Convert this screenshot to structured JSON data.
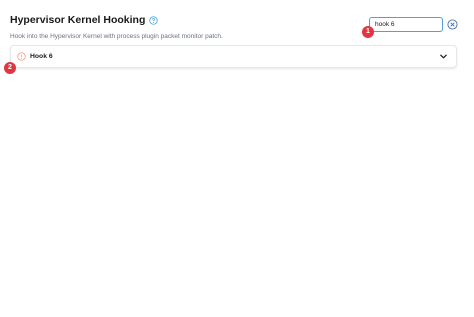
{
  "header": {
    "title": "Hypervisor Kernel Hooking",
    "subtitle": "Hook into the Hypervisor Kernel with process plugin packet monitor patch.",
    "help_icon": "help-circle-icon"
  },
  "search": {
    "value": "hook 6",
    "clear_icon": "clear-circle-icon"
  },
  "annotations": [
    "1",
    "2"
  ],
  "card": {
    "title": "Hook 6",
    "status_icon": "warning-circle-icon",
    "expand_icon": "chevron-down-icon"
  },
  "colors": {
    "accent": "#4aa3df",
    "marker": "#e0363f",
    "warning": "#f0a08c"
  }
}
